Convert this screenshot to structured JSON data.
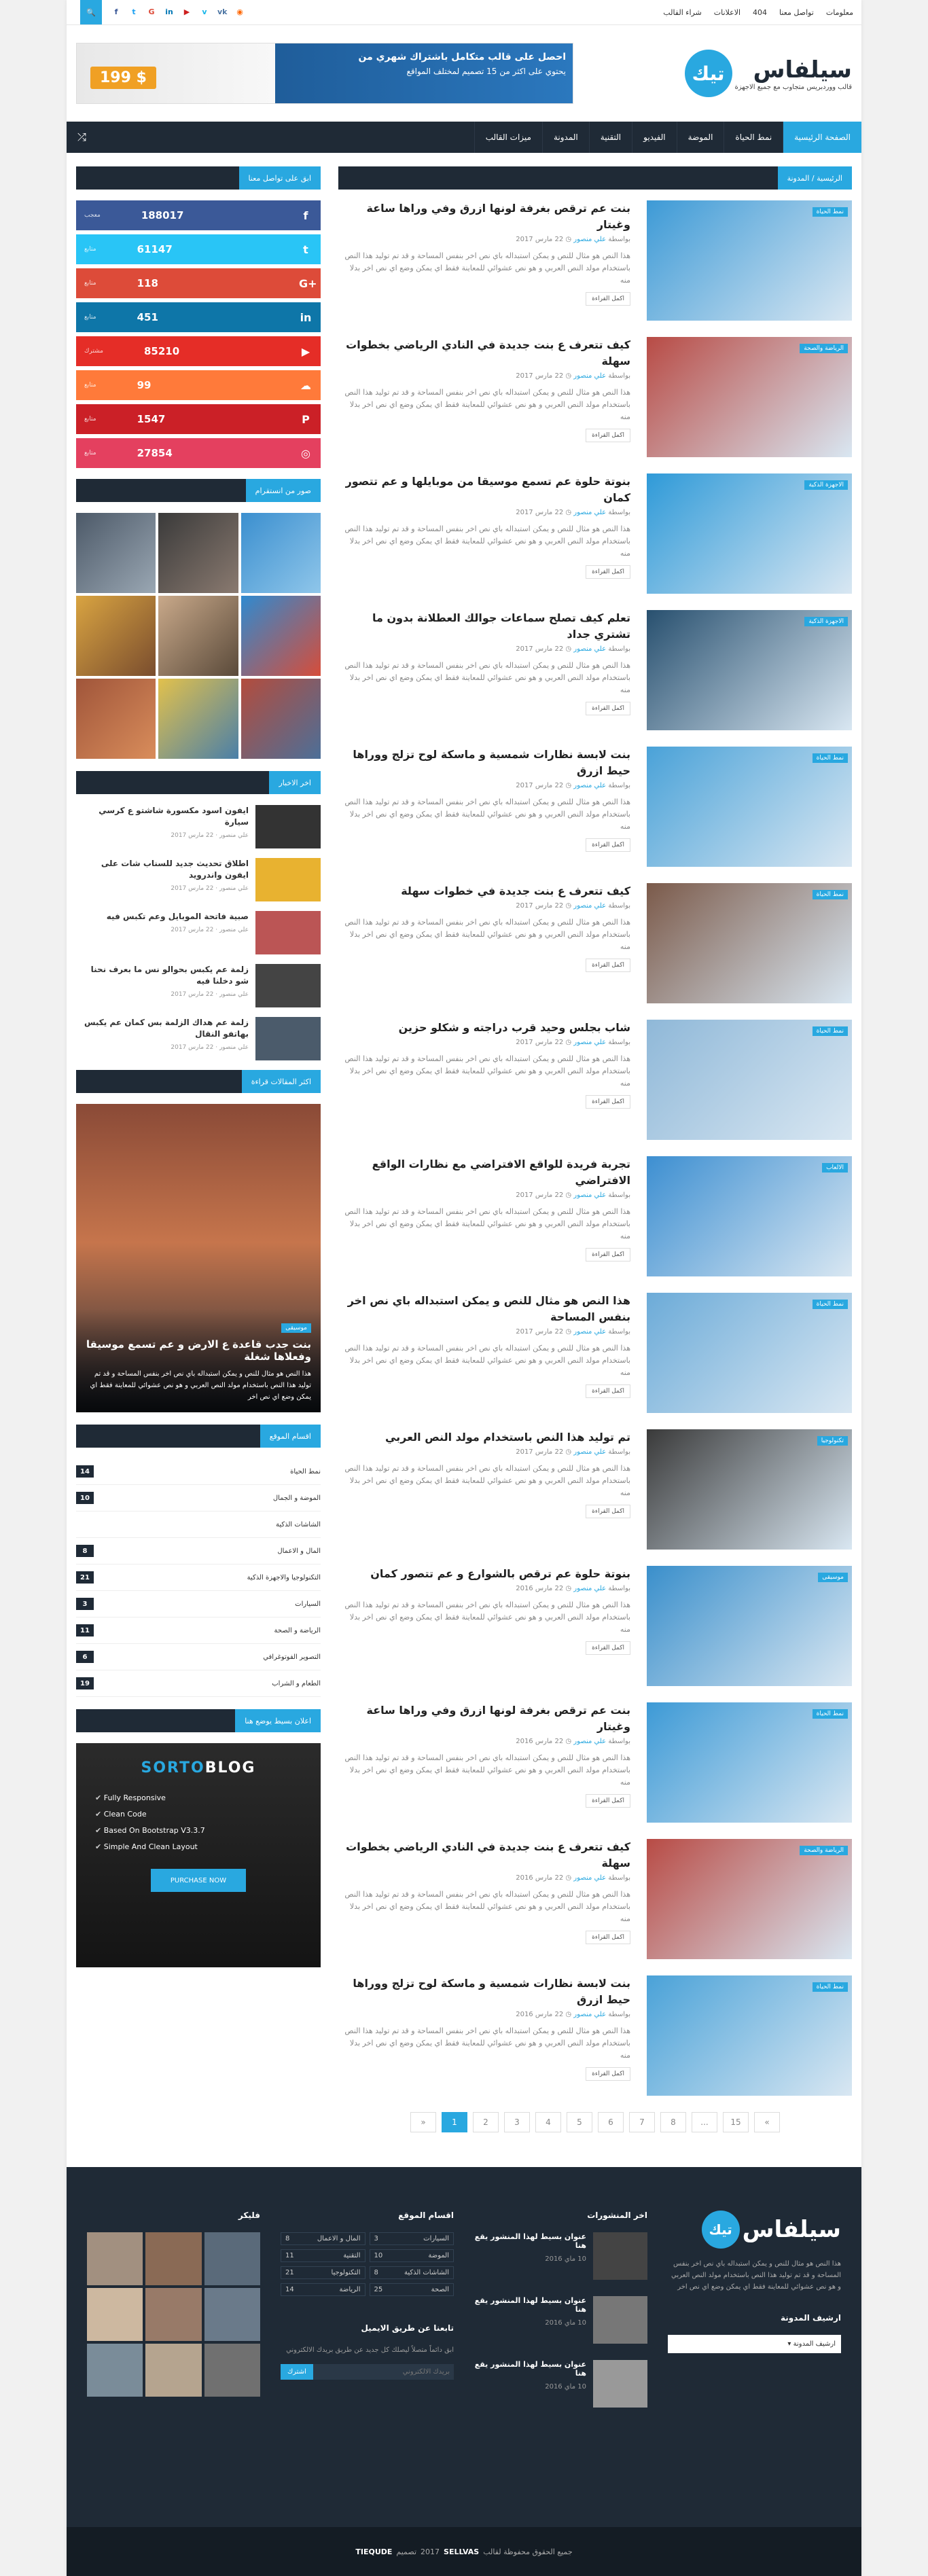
{
  "topbar": {
    "links": [
      "معلومات",
      "تواصل معنا",
      "404",
      "الاعلانات",
      "شراء القالب"
    ],
    "social": [
      {
        "name": "facebook-icon",
        "glyph": "f",
        "color": "#3b5998"
      },
      {
        "name": "twitter-icon",
        "glyph": "t",
        "color": "#1da1f2"
      },
      {
        "name": "google-plus-icon",
        "glyph": "G",
        "color": "#dd4b39"
      },
      {
        "name": "linkedin-icon",
        "glyph": "in",
        "color": "#0077b5"
      },
      {
        "name": "youtube-icon",
        "glyph": "▶",
        "color": "#cd201f"
      },
      {
        "name": "vimeo-icon",
        "glyph": "v",
        "color": "#1ab7ea"
      },
      {
        "name": "vk-icon",
        "glyph": "vk",
        "color": "#4c75a3"
      },
      {
        "name": "rss-icon",
        "glyph": "◉",
        "color": "#ff6600"
      }
    ]
  },
  "logo": {
    "title": "سيلفاس",
    "badge": "تيك",
    "subtitle": "قالب ووردبريس متجاوب مع جميع الاجهزة"
  },
  "banner": {
    "line1": "احصل على قالب متكامل باشتراك شهري من",
    "price": "199 $",
    "line2": "يحتوي على اكثر من 15 تصميم لمختلف المواقع"
  },
  "nav": {
    "items": [
      "الصفحة الرئيسية",
      "نمط الحياة",
      "الموضة",
      "الفيديو",
      "التقنية",
      "المدونة",
      "ميزات القالب"
    ],
    "active_index": 0
  },
  "breadcrumb": "الرئيسية / المدونة",
  "sidebar": {
    "follow_title": "ابق على تواصل معنا",
    "counters": [
      {
        "network": "facebook",
        "icon": "f",
        "count": "188017",
        "label": "معجب",
        "color": "#3b5998"
      },
      {
        "network": "twitter",
        "icon": "t",
        "count": "61147",
        "label": "متابع",
        "color": "#29c5f6"
      },
      {
        "network": "google-plus",
        "icon": "G+",
        "count": "118",
        "label": "متابع",
        "color": "#dd4b39"
      },
      {
        "network": "linkedin",
        "icon": "in",
        "count": "451",
        "label": "متابع",
        "color": "#0e76a8"
      },
      {
        "network": "youtube",
        "icon": "▶",
        "count": "85210",
        "label": "مشترك",
        "color": "#e52d27"
      },
      {
        "network": "soundcloud",
        "icon": "☁",
        "count": "99",
        "label": "متابع",
        "color": "#ff7a3a"
      },
      {
        "network": "pinterest",
        "icon": "P",
        "count": "1547",
        "label": "متابع",
        "color": "#cb2027"
      },
      {
        "network": "instagram",
        "icon": "◎",
        "count": "27854",
        "label": "متابع",
        "color": "#e4405f"
      }
    ],
    "instagram_title": "صور من انستقرام",
    "recent_title": "اخر الاخبار",
    "recent": [
      {
        "title": "ايفون اسود مكسورة شاشتو ع كرسي سيارة",
        "meta": "علي منصور · 22 مارس 2017"
      },
      {
        "title": "اطلاق تحديث جديد للسناب شات على ايفون واندرويد",
        "meta": "علي منصور · 22 مارس 2017"
      },
      {
        "title": "صبية فاتحة الموبايل وعم تكبس فيه",
        "meta": "علي منصور · 22 مارس 2017"
      },
      {
        "title": "زلمة عم يكبس بحوالو نس ما بعرف نحنا شو دخلنا فيه",
        "meta": "علي منصور · 22 مارس 2017"
      },
      {
        "title": "زلمة عم هداك الزلمة بس كمان عم يكبس بهاتفو النقال",
        "meta": "علي منصور · 22 مارس 2017"
      }
    ],
    "popular_title": "اكثر المقالات قراءة",
    "featured": {
      "tag": "موسيقى",
      "title": "بنت جدب قاعدة ع الارض و عم تسمع موسيقا وفعلاها شغلة",
      "excerpt": "هذا النص هو مثال للنص و يمكن استبداله باي نص اخر بنفس المساحة و قد تم توليد هذا النص باستخدام مولد النص العربي و هو نص عشوائي للمعاينة فقط اي يمكن وضع اي نص اخر"
    },
    "categories_title": "اقسام الموقع",
    "categories": [
      {
        "name": "نمط الحياة",
        "count": "14"
      },
      {
        "name": "الموضة و الجمال",
        "count": "10"
      },
      {
        "name": "الشاشات الذكية",
        "count": ""
      },
      {
        "name": "المال و الاعمال",
        "count": "8"
      },
      {
        "name": "التكنولوجيا والاجهزة الذكية",
        "count": "21"
      },
      {
        "name": "السيارات",
        "count": "3"
      },
      {
        "name": "الرياضة و الصحة",
        "count": "11"
      },
      {
        "name": "التصوير الفوتوغرافي",
        "count": "6"
      },
      {
        "name": "الطعام و الشراب",
        "count": "19"
      }
    ],
    "ad_title": "اعلان بسيط يوضع هنا",
    "ad": {
      "brand_a": "SORTO",
      "brand_b": "BLOG",
      "features": [
        "Fully Responsive",
        "Clean Code",
        "Based On Bootstrap V3.3.7",
        "Simple And Clean Layout"
      ],
      "button": "PURCHASE NOW"
    }
  },
  "posts": [
    {
      "title": "بنت عم ترقص بغرفة لونها ازرق وفي وراها ساعة وغيتار",
      "cat": "نمط الحياة",
      "date": "22 مارس 2017",
      "bg": "#3d9ad6"
    },
    {
      "title": "كيف تتعرف ع بنت جديدة في النادي الرياضي بخطوات سهلة",
      "cat": "الرياضة والصحة",
      "date": "22 مارس 2017",
      "bg": "#b84b45"
    },
    {
      "title": "بنوتة حلوة عم تسمع موسيقا من موبايلها و عم تتصور كمان",
      "cat": "الاجهزة الذكية",
      "date": "22 مارس 2017",
      "bg": "#2f9ad8"
    },
    {
      "title": "تعلم كيف تصلح سماعات جوالك العطلانة بدون ما تشتري جداد",
      "cat": "الاجهزة الذكية",
      "date": "22 مارس 2017",
      "bg": "#28506f"
    },
    {
      "title": "بنت لابسة نظارات شمسية و ماسكة لوح تزلج ووراها حيط ازرق",
      "cat": "نمط الحياة",
      "date": "22 مارس 2017",
      "bg": "#4aa2d8"
    },
    {
      "title": "كيف تتعرف ع بنت جديدة في خطوات سهلة",
      "cat": "نمط الحياة",
      "date": "22 مارس 2017",
      "bg": "#7b5a4a"
    },
    {
      "title": "شاب بجلس وحيد قرب دراجته و شكلو حزين",
      "cat": "نمط الحياة",
      "date": "22 مارس 2017",
      "bg": "#8fb8d8"
    },
    {
      "title": "تجربة فريدة للواقع الافتراضي مع نظارات الواقع الافتراضي",
      "cat": "الالعاب",
      "date": "22 مارس 2017",
      "bg": "#3d8fd1"
    },
    {
      "title": "هذا النص هو مثال للنص و يمكن استبداله باي نص اخر بنفس المساحة",
      "cat": "نمط الحياة",
      "date": "22 مارس 2017",
      "bg": "#6cabd8"
    },
    {
      "title": "تم توليد هذا النص باستخدام مولد النص العربي",
      "cat": "تكنولوجيا",
      "date": "22 مارس 2017",
      "bg": "#3a3a3a"
    },
    {
      "title": "بنوتة حلوة عم ترقص بالشوارع و عم تتصور كمان",
      "cat": "موسيقى",
      "date": "22 مارس 2016",
      "bg": "#3a8fcb"
    },
    {
      "title": "بنت عم ترقص بغرفة لونها ازرق وفي وراها ساعة وغيتار",
      "cat": "نمط الحياة",
      "date": "22 مارس 2016",
      "bg": "#3d9ad6"
    },
    {
      "title": "كيف تتعرف ع بنت جديدة في النادي الرياضي بخطوات سهلة",
      "cat": "الرياضة والصحة",
      "date": "22 مارس 2016",
      "bg": "#b84b45"
    },
    {
      "title": "بنت لابسة نظارات شمسية و ماسكة لوح تزلج ووراها حيط ازرق",
      "cat": "نمط الحياة",
      "date": "22 مارس 2016",
      "bg": "#4aa2d8"
    }
  ],
  "post_common": {
    "author": "علي منصور",
    "author_prefix": "بواسطة",
    "excerpt": "هذا النص هو مثال للنص و يمكن استبداله باي نص اخر بنفس المساحة و قد تم توليد هذا النص باستخدام مولد النص العربي و هو نص عشوائي للمعاينة فقط اي يمكن وضع اي نص اخر بدلا منه",
    "read_more": "اكمل القراءة"
  },
  "pagination": [
    "»",
    "1",
    "2",
    "3",
    "4",
    "5",
    "6",
    "7",
    "8",
    "...",
    "15",
    "«"
  ],
  "pagination_active": "1",
  "footer": {
    "about_title": "سيلفاس",
    "about_text": "هذا النص هو مثال للنص و يمكن استبداله باي نص اخر بنفس المساحة و قد تم توليد هذا النص باستخدام مولد النص العربي و هو نص عشوائي للمعاينة فقط اي يمكن وضع اي نص اخر",
    "archive_title": "ارشيف المدونة",
    "archive_select": "ارشيف المدونة",
    "latest_title": "اخر المنشورات",
    "latest": [
      {
        "title": "عنوان بسيط لهذا المنشور يقع هنا",
        "date": "10 ماي 2016"
      },
      {
        "title": "عنوان بسيط لهذا المنشور يقع هنا",
        "date": "10 ماي 2016"
      },
      {
        "title": "عنوان بسيط لهذا المنشور يقع هنا",
        "date": "10 ماي 2016"
      }
    ],
    "cats_title": "اقسام الموقع",
    "cats": [
      {
        "name": "السيارات",
        "count": "3"
      },
      {
        "name": "المال و الاعمال",
        "count": "8"
      },
      {
        "name": "الموضة",
        "count": "10"
      },
      {
        "name": "التقنية",
        "count": "11"
      },
      {
        "name": "الشاشات الذكية",
        "count": "8"
      },
      {
        "name": "التكنولوجيا",
        "count": "21"
      },
      {
        "name": "الصحة",
        "count": "25"
      },
      {
        "name": "الرياضة",
        "count": "14"
      }
    ],
    "newsletter_title": "تابعنا عن طريق الايميل",
    "newsletter_text": "ابق دائماً متصلاً ليصلك كل جديد عن طريق بريدك الالكتروني",
    "newsletter_placeholder": "بريدك الالكتروني",
    "newsletter_button": "اشترك",
    "gallery_title": "فليكر"
  },
  "copyright": {
    "prefix": "جميع الحقوق محفوظة لقالب",
    "brand": "SELLVAS",
    "year": "2017",
    "made": "تصميم",
    "studio": "TIEQUDE"
  }
}
